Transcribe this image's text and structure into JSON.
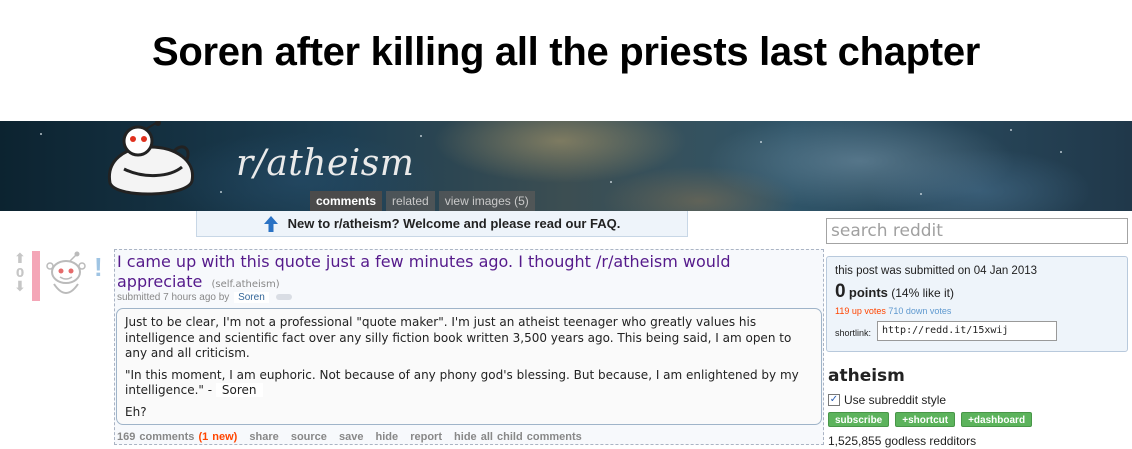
{
  "meme": {
    "caption": "Soren after killing all the priests last chapter"
  },
  "header": {
    "subreddit_name": "r/atheism",
    "tabs": [
      {
        "label": "comments",
        "active": true
      },
      {
        "label": "related",
        "active": false
      },
      {
        "label": "view images (5)",
        "active": false
      }
    ]
  },
  "faq_bar": {
    "text": "New to r/atheism? Welcome and please read our FAQ."
  },
  "vote": {
    "score": "0"
  },
  "post": {
    "title": "I came up with this quote just a few minutes ago. I thought /r/atheism would appreciate",
    "domain": "(self.atheism)",
    "submitted_prefix": "submitted 7 hours ago by",
    "author": "Soren",
    "selftext": {
      "paragraph1": "Just to be clear, I'm not a professional \"quote maker\". I'm just an atheist teenager who greatly values his intelligence and scientific fact over any silly fiction book written 3,500 years ago. This being said, I am open to any and all criticism.",
      "paragraph2_quote": "\"In this moment, I am euphoric. Not because of any phony god's blessing. But because, I am enlightened by my intelligence.\" -",
      "paragraph2_author": "Soren",
      "paragraph3": "Eh?"
    },
    "actions": {
      "comments": "169 comments",
      "new": "(1 new)",
      "share": "share",
      "source": "source",
      "save": "save",
      "hide": "hide",
      "report": "report",
      "hide_children": "hide all child comments"
    }
  },
  "sidebar": {
    "search_placeholder": "search reddit",
    "submitted_on": "this post was submitted on 04 Jan 2013",
    "points_value": "0",
    "points_label": "points",
    "points_like": "(14% like it)",
    "up_votes": "119 up votes",
    "down_votes": "710 down votes",
    "shortlink_label": "shortlink:",
    "shortlink_value": "http://redd.it/15xwij",
    "sr_title": "atheism",
    "use_style_label": "Use subreddit style",
    "use_style_checked": true,
    "buttons": {
      "subscribe": "subscribe",
      "shortcut": "+shortcut",
      "dashboard": "+dashboard"
    },
    "subscribers": "1,525,855 godless redditors"
  },
  "colors": {
    "title_link": "#551a8b",
    "author_link": "#336699",
    "new_count": "#ff4500",
    "up_votes": "#ff4500",
    "down_votes": "#5f99cf",
    "sidebar_button": "#5cb35c",
    "downvote_bar": "#f4a6b7"
  }
}
